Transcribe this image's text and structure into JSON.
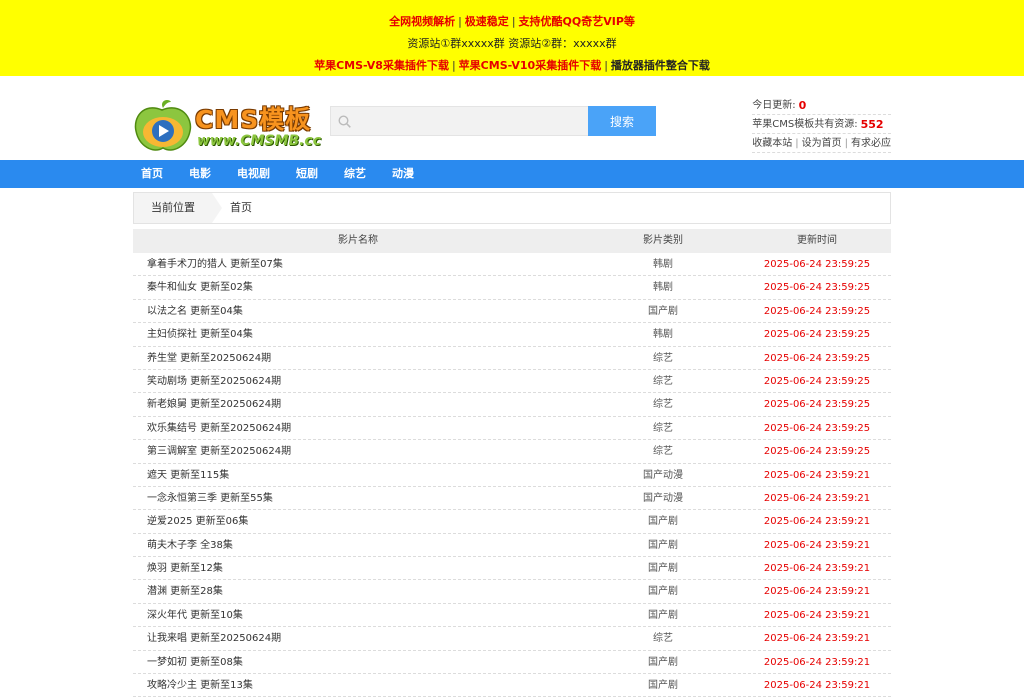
{
  "banner": {
    "line1": [
      "全网视频解析",
      "极速稳定",
      "支持优酷QQ奇艺VIP等"
    ],
    "line2": "资源站①群xxxxx群 资源站②群：xxxxx群",
    "line3": [
      "苹果CMS-V8采集插件下载",
      "苹果CMS-V10采集插件下载",
      "播放器插件整合下载"
    ]
  },
  "logo": {
    "brand": "CMS模板",
    "url": "www.CMSMB.cc"
  },
  "search": {
    "placeholder": "",
    "value": "",
    "button": "搜索"
  },
  "stats": {
    "today_label": "今日更新:",
    "today_count": "0",
    "total_label": "苹果CMS模板共有资源:",
    "total_count": "552",
    "links": [
      "收藏本站",
      "设为首页",
      "有求必应"
    ]
  },
  "nav": [
    "首页",
    "电影",
    "电视剧",
    "短剧",
    "综艺",
    "动漫"
  ],
  "breadcrumb": {
    "label": "当前位置",
    "current": "首页"
  },
  "table": {
    "headers": [
      "影片名称",
      "影片类别",
      "更新时间"
    ],
    "rows": [
      {
        "name": "拿着手术刀的猎人 更新至07集",
        "cat": "韩剧",
        "time": "2025-06-24 23:59:25"
      },
      {
        "name": "秦牛和仙女 更新至02集",
        "cat": "韩剧",
        "time": "2025-06-24 23:59:25"
      },
      {
        "name": "以法之名 更新至04集",
        "cat": "国产剧",
        "time": "2025-06-24 23:59:25"
      },
      {
        "name": "主妇侦探社 更新至04集",
        "cat": "韩剧",
        "time": "2025-06-24 23:59:25"
      },
      {
        "name": "养生堂 更新至20250624期",
        "cat": "综艺",
        "time": "2025-06-24 23:59:25"
      },
      {
        "name": "笑动剧场 更新至20250624期",
        "cat": "综艺",
        "time": "2025-06-24 23:59:25"
      },
      {
        "name": "新老娘舅 更新至20250624期",
        "cat": "综艺",
        "time": "2025-06-24 23:59:25"
      },
      {
        "name": "欢乐集结号 更新至20250624期",
        "cat": "综艺",
        "time": "2025-06-24 23:59:25"
      },
      {
        "name": "第三调解室 更新至20250624期",
        "cat": "综艺",
        "time": "2025-06-24 23:59:25"
      },
      {
        "name": "遮天 更新至115集",
        "cat": "国产动漫",
        "time": "2025-06-24 23:59:21"
      },
      {
        "name": "一念永恒第三季 更新至55集",
        "cat": "国产动漫",
        "time": "2025-06-24 23:59:21"
      },
      {
        "name": "逆爱2025 更新至06集",
        "cat": "国产剧",
        "time": "2025-06-24 23:59:21"
      },
      {
        "name": "萌夫木子李 全38集",
        "cat": "国产剧",
        "time": "2025-06-24 23:59:21"
      },
      {
        "name": "焕羽 更新至12集",
        "cat": "国产剧",
        "time": "2025-06-24 23:59:21"
      },
      {
        "name": "潜渊 更新至28集",
        "cat": "国产剧",
        "time": "2025-06-24 23:59:21"
      },
      {
        "name": "深火年代 更新至10集",
        "cat": "国产剧",
        "time": "2025-06-24 23:59:21"
      },
      {
        "name": "让我来唱 更新至20250624期",
        "cat": "综艺",
        "time": "2025-06-24 23:59:21"
      },
      {
        "name": "一梦如初 更新至08集",
        "cat": "国产剧",
        "time": "2025-06-24 23:59:21"
      },
      {
        "name": "攻略冷少主 更新至13集",
        "cat": "国产剧",
        "time": "2025-06-24 23:59:21"
      }
    ]
  }
}
